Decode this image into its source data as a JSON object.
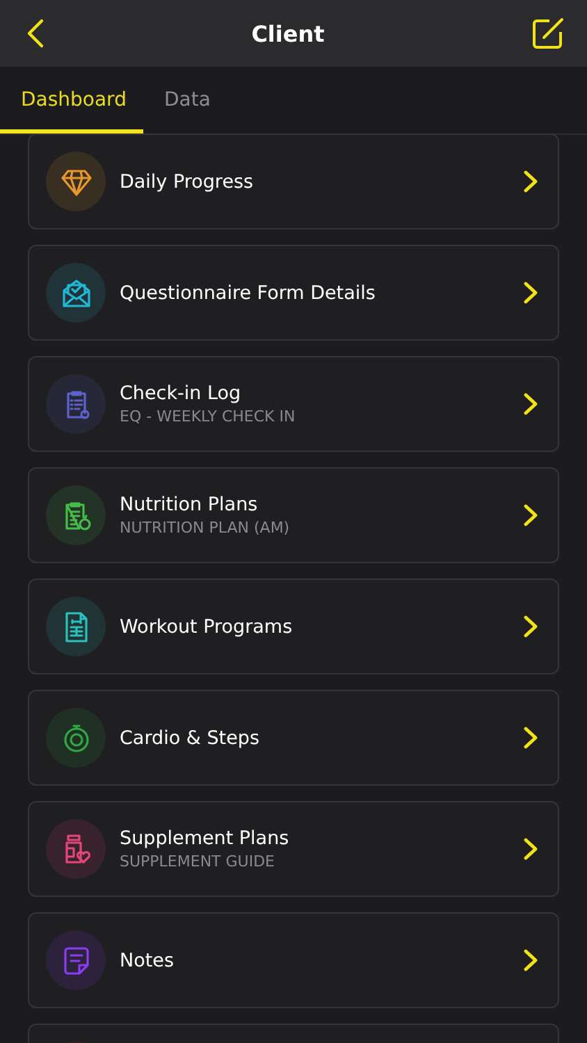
{
  "header": {
    "title": "Client"
  },
  "tabs": [
    {
      "label": "Dashboard",
      "selected": true
    },
    {
      "label": "Data",
      "selected": false
    }
  ],
  "items": [
    {
      "kind": "diamond",
      "color": "#e8982a",
      "title": "Daily Progress"
    },
    {
      "kind": "envelope",
      "color": "#22b8d4",
      "title": "Questionnaire Form Details"
    },
    {
      "kind": "checklist",
      "color": "#5c62c8",
      "title": "Check-in Log",
      "subtitle": "EQ - WEEKLY CHECK IN"
    },
    {
      "kind": "nutrition",
      "color": "#46bb4a",
      "title": "Nutrition Plans",
      "subtitle": "NUTRITION PLAN (AM)"
    },
    {
      "kind": "document",
      "color": "#2cc0bc",
      "title": "Workout Programs"
    },
    {
      "kind": "stopwatch",
      "color": "#2fa843",
      "title": "Cardio & Steps"
    },
    {
      "kind": "bottle",
      "color": "#e4467c",
      "title": "Supplement Plans",
      "subtitle": "SUPPLEMENT GUIDE"
    },
    {
      "kind": "note",
      "color": "#8a3cf2",
      "title": "Notes"
    },
    {
      "kind": "partial"
    }
  ]
}
